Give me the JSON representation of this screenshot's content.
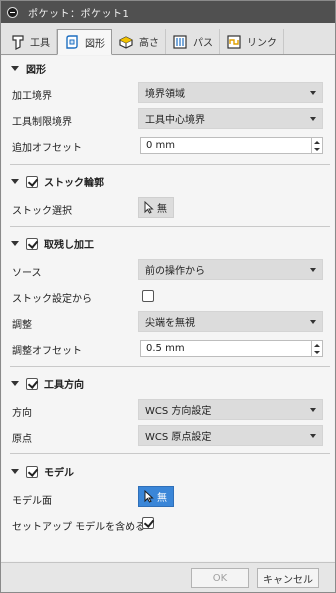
{
  "titlebar": {
    "title": "ポケット：ポケット1"
  },
  "tabs": [
    {
      "label": "工具",
      "icon": "tool-icon"
    },
    {
      "label": "図形",
      "icon": "geometry-icon"
    },
    {
      "label": "高さ",
      "icon": "heights-icon"
    },
    {
      "label": "パス",
      "icon": "passes-icon"
    },
    {
      "label": "リンク",
      "icon": "linking-icon"
    }
  ],
  "geometry": {
    "title": "図形",
    "machining_boundary_label": "加工境界",
    "machining_boundary_value": "境界領域",
    "tool_containment_label": "工具制限境界",
    "tool_containment_value": "工具中心境界",
    "additional_offset_label": "追加オフセット",
    "additional_offset_value": "0 mm"
  },
  "stock_contours": {
    "title": "ストック輪郭",
    "checked": true,
    "stock_selection_label": "ストック選択",
    "stock_selection_value": "無"
  },
  "rest_machining": {
    "title": "取残し加工",
    "checked": true,
    "source_label": "ソース",
    "source_value": "前の操作から",
    "from_stock_setup_label": "ストック設定から",
    "from_stock_setup_checked": false,
    "adjustment_label": "調整",
    "adjustment_value": "尖端を無視",
    "adjustment_offset_label": "調整オフセット",
    "adjustment_offset_value": "0.5 mm"
  },
  "tool_orientation": {
    "title": "工具方向",
    "checked": true,
    "orientation_label": "方向",
    "orientation_value": "WCS 方向設定",
    "origin_label": "原点",
    "origin_value": "WCS 原点設定"
  },
  "model": {
    "title": "モデル",
    "checked": true,
    "model_surfaces_label": "モデル面",
    "model_surfaces_value": "無",
    "include_setup_model_label": "セットアップ モデルを含める",
    "include_setup_model_checked": true
  },
  "footer": {
    "ok_label": "OK",
    "cancel_label": "キャンセル"
  },
  "colors": {
    "titlebar": "#505050",
    "selection_active": "#3a86d8"
  }
}
